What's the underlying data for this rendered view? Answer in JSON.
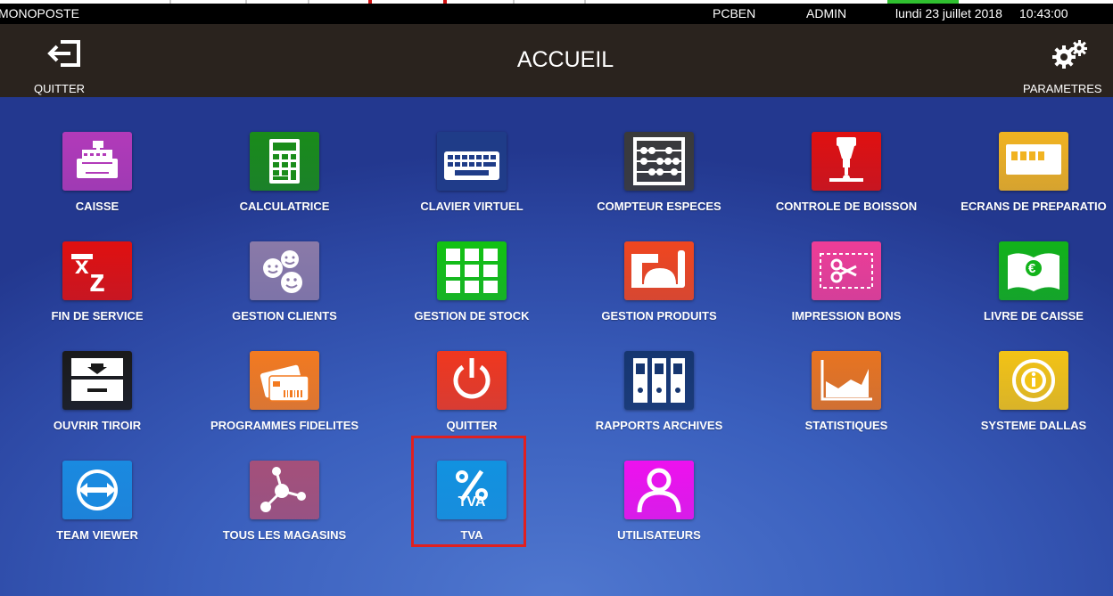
{
  "topbar": {
    "mode": "MONOPOSTE",
    "station": "PCBEN",
    "user": "ADMIN",
    "date": "lundi 23 juillet 2018",
    "time": "10:43:00"
  },
  "header": {
    "title": "ACCUEIL",
    "quit_label": "QUITTER",
    "settings_label": "PARAMETRES"
  },
  "tiles": [
    {
      "label": "CAISSE",
      "icon": "cash-register-icon",
      "color": "#b23ab9"
    },
    {
      "label": "CALCULATRICE",
      "icon": "calculator-icon",
      "color": "#1a8c1a"
    },
    {
      "label": "CLAVIER VIRTUEL",
      "icon": "keyboard-icon",
      "color": "#1f3c88"
    },
    {
      "label": "COMPTEUR ESPECES",
      "icon": "abacus-icon",
      "color": "#3a3a3a"
    },
    {
      "label": "CONTROLE DE BOISSON",
      "icon": "beer-tap-icon",
      "color": "#e01010"
    },
    {
      "label": "ECRANS DE PREPARATIO",
      "icon": "display-screen-icon",
      "color": "#f1b321"
    },
    {
      "label": "FIN DE SERVICE",
      "icon": "xz-report-icon",
      "color": "#e01010"
    },
    {
      "label": "GESTION CLIENTS",
      "icon": "smiley-customers-icon",
      "color": "#8a7aa8"
    },
    {
      "label": "GESTION DE STOCK",
      "icon": "stock-grid-icon",
      "color": "#12c212"
    },
    {
      "label": "GESTION PRODUITS",
      "icon": "products-cloche-icon",
      "color": "#f0461f"
    },
    {
      "label": "IMPRESSION BONS",
      "icon": "coupon-scissors-icon",
      "color": "#ee3d97"
    },
    {
      "label": "LIVRE DE CAISSE",
      "icon": "euro-book-icon",
      "color": "#12b31a"
    },
    {
      "label": "OUVRIR TIROIR",
      "icon": "cash-drawer-icon",
      "color": "#1a1a1a"
    },
    {
      "label": "PROGRAMMES FIDELITES",
      "icon": "loyalty-cards-icon",
      "color": "#f37a20"
    },
    {
      "label": "QUITTER",
      "icon": "power-icon",
      "color": "#f0371e"
    },
    {
      "label": "RAPPORTS ARCHIVES",
      "icon": "binders-icon",
      "color": "#163670"
    },
    {
      "label": "STATISTIQUES",
      "icon": "area-chart-icon",
      "color": "#e87420"
    },
    {
      "label": "SYSTEME DALLAS",
      "icon": "dallas-key-icon",
      "color": "#f3c315"
    },
    {
      "label": "TEAM VIEWER",
      "icon": "teamviewer-icon",
      "color": "#1a8ae0"
    },
    {
      "label": "TOUS LES MAGASINS",
      "icon": "network-icon",
      "color": "#a5507a"
    },
    {
      "label": "TVA",
      "icon": "percent-tva-icon",
      "color": "#1192e0",
      "icon_text": "TVA"
    },
    {
      "label": "UTILISATEURS",
      "icon": "user-icon",
      "color": "#ee11ee"
    }
  ]
}
